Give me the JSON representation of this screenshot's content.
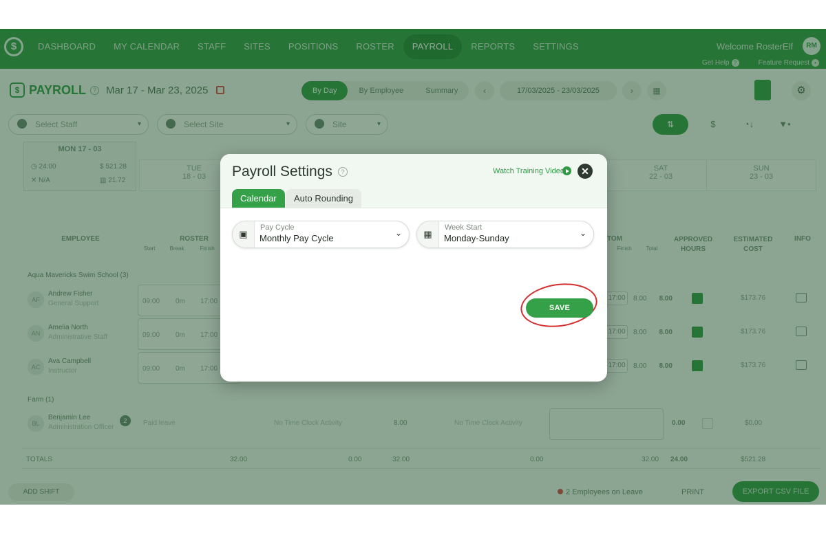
{
  "nav": {
    "logo": "$",
    "items": [
      "DASHBOARD",
      "MY CALENDAR",
      "STAFF",
      "SITES",
      "POSITIONS",
      "ROSTER",
      "PAYROLL",
      "REPORTS",
      "SETTINGS"
    ],
    "active": "PAYROLL",
    "welcome": "Welcome RosterElf",
    "avatar": "RM",
    "get_help": "Get Help",
    "feature_request": "Feature Request"
  },
  "toolbar": {
    "title": "PAYROLL",
    "date_range": "Mar 17 - Mar 23, 2025",
    "views": [
      "By Day",
      "By Employee",
      "Summary"
    ],
    "active_view": "By Day",
    "date_field": "17/03/2025 - 23/03/2025",
    "prev": "‹",
    "next": "›"
  },
  "filters": {
    "staff_placeholder": "Select Staff",
    "site_placeholder": "Select Site",
    "group_by": "Site",
    "money_icon": "$"
  },
  "days": {
    "selected": "MON 17 - 03",
    "hours": "24:00",
    "cost": "$ 521.28",
    "na": "N/A",
    "stat": "21.72",
    "others": [
      {
        "name": "TUE",
        "date": "18 - 03"
      },
      {
        "name": "SAT",
        "date": "22 - 03"
      },
      {
        "name": "SUN",
        "date": "23 - 03"
      }
    ]
  },
  "headers": {
    "employee": "EMPLOYEE",
    "roster": "ROSTER",
    "roster_sub": [
      "Start",
      "Break",
      "Finish"
    ],
    "custom": "TOM",
    "custom_sub": [
      "Finish",
      "Total"
    ],
    "approved": "APPROVED HOURS",
    "cost": "ESTIMATED COST",
    "info": "INFO"
  },
  "groups": [
    {
      "name": "Aqua Mavericks Swim School (3)",
      "employees": [
        {
          "initials": "AF",
          "name": "Andrew Fisher",
          "role": "General Support",
          "start": "09:00",
          "break": "0m",
          "finish": "17:00",
          "tfinish": "17:00",
          "total": "8.00",
          "approved": "8.00",
          "cost": "$173.76"
        },
        {
          "initials": "AN",
          "name": "Amelia North",
          "role": "Administrative Staff",
          "start": "09:00",
          "break": "0m",
          "finish": "17:00",
          "tfinish": "17:00",
          "total": "8.00",
          "approved": "8.00",
          "cost": "$173.76"
        },
        {
          "initials": "AC",
          "name": "Ava Campbell",
          "role": "Instructor",
          "start": "09:00",
          "break": "0m",
          "finish": "17:00",
          "tfinish": "17:00",
          "total": "8.00",
          "approved": "8.00",
          "cost": "$173.76"
        }
      ]
    },
    {
      "name": "Farm (1)",
      "employees": [
        {
          "initials": "BL",
          "name": "Benjamin Lee",
          "role": "Administration Officer",
          "badge": "2",
          "roster_text": "Paid leave",
          "no_clock": "No Time Clock Activity",
          "hours": "8.00",
          "approved": "0.00",
          "cost": "$0.00"
        }
      ]
    }
  ],
  "totals": {
    "label": "TOTALS",
    "roster": "32.00",
    "clock": "0.00",
    "hours": "32.00",
    "other": "0.00",
    "custom_total": "32.00",
    "approved": "24.00",
    "cost": "$521.28"
  },
  "bottom": {
    "add_shift": "ADD SHIFT",
    "on_leave": "2 Employees on Leave",
    "print": "PRINT",
    "export": "EXPORT CSV FILE"
  },
  "modal": {
    "title": "Payroll Settings",
    "help": "?",
    "video_link": "Watch Training Video",
    "close": "✕",
    "tabs": [
      "Calendar",
      "Auto Rounding"
    ],
    "active_tab": "Calendar",
    "pay_cycle": {
      "label": "Pay Cycle",
      "value": "Monthly Pay Cycle"
    },
    "week_start": {
      "label": "Week Start",
      "value": "Monday-Sunday"
    },
    "save": "SAVE"
  },
  "colors": {
    "brand": "#3aa14e",
    "accent_red": "#d32f2f"
  }
}
